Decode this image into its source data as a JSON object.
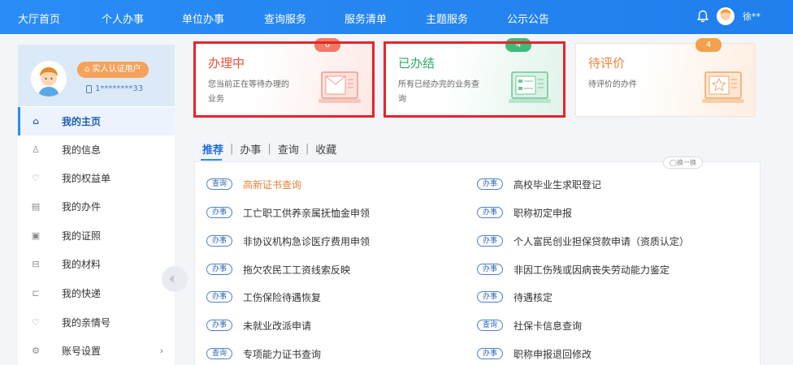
{
  "topnav": {
    "items": [
      "大厅首页",
      "个人办事",
      "单位办事",
      "查询服务",
      "服务清单",
      "主题服务",
      "公示公告"
    ],
    "user_name": "徐**"
  },
  "sidebar": {
    "auth_badge": "实人认证用户",
    "phone": "1********33",
    "items": [
      {
        "label": "我的主页",
        "icon": "home-icon"
      },
      {
        "label": "我的信息",
        "icon": "user-icon"
      },
      {
        "label": "我的权益单",
        "icon": "heart-shield-icon"
      },
      {
        "label": "我的办件",
        "icon": "document-icon"
      },
      {
        "label": "我的证照",
        "icon": "id-card-icon"
      },
      {
        "label": "我的材料",
        "icon": "folder-icon"
      },
      {
        "label": "我的快递",
        "icon": "truck-icon"
      },
      {
        "label": "我的亲情号",
        "icon": "family-icon"
      },
      {
        "label": "账号设置",
        "icon": "settings-icon"
      }
    ],
    "settings_arrow": "›"
  },
  "cards": [
    {
      "title": "办理中",
      "desc": "您当前正在等待办理的业务",
      "count": "0",
      "title_color": "#e8533a",
      "badge_color": "#f07a66"
    },
    {
      "title": "已办结",
      "desc": "所有已经办完的业务查询",
      "count": "4",
      "title_color": "#2fa867",
      "badge_color": "#3cbc7a"
    },
    {
      "title": "待评价",
      "desc": "待评价的办件",
      "count": "4",
      "title_color": "#e8833a",
      "badge_color": "#f3a14a"
    }
  ],
  "tabs": {
    "items": [
      "推荐",
      "办事",
      "查询",
      "收藏"
    ],
    "separator": "|",
    "shuffle_label": "◯换一换"
  },
  "services": {
    "left": [
      {
        "tag": "查询",
        "name": "高新证书查询",
        "highlight": true
      },
      {
        "tag": "办事",
        "name": "工亡职工供养亲属抚恤金申领"
      },
      {
        "tag": "办事",
        "name": "非协议机构急诊医疗费用申领"
      },
      {
        "tag": "办事",
        "name": "拖欠农民工工资线索反映"
      },
      {
        "tag": "办事",
        "name": "工伤保险待遇恢复"
      },
      {
        "tag": "办事",
        "name": "未就业改派申请"
      },
      {
        "tag": "查询",
        "name": "专项能力证书查询"
      }
    ],
    "right": [
      {
        "tag": "办事",
        "name": "高校毕业生求职登记"
      },
      {
        "tag": "办事",
        "name": "职称初定申报"
      },
      {
        "tag": "办事",
        "name": "个人富民创业担保贷款申请（资质认定）"
      },
      {
        "tag": "办事",
        "name": "非因工伤残或因病丧失劳动能力鉴定"
      },
      {
        "tag": "办事",
        "name": "待遇核定"
      },
      {
        "tag": "查询",
        "name": "社保卡信息查询"
      },
      {
        "tag": "办事",
        "name": "职称申报退回修改"
      }
    ]
  }
}
